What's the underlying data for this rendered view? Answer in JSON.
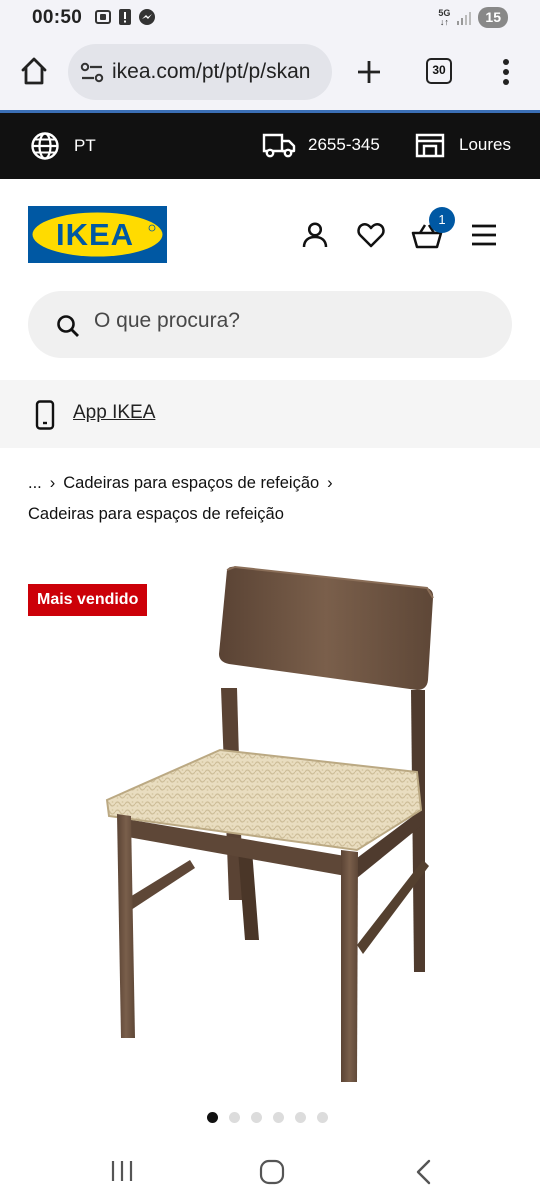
{
  "status_bar": {
    "time": "00:50",
    "network": "5G",
    "battery": "15"
  },
  "browser": {
    "url": "ikea.com/pt/pt/p/skan",
    "tab_count": "30"
  },
  "top_bar": {
    "language": "PT",
    "phone": "2655-345",
    "store": "Loures"
  },
  "header": {
    "logo_text": "IKEA",
    "cart_count": "1"
  },
  "search": {
    "placeholder": "O que procura?"
  },
  "app_banner": {
    "label": "App IKEA"
  },
  "breadcrumb": {
    "ellipsis": "...",
    "parent": "Cadeiras para espaços de refeição",
    "current": "Cadeiras para espaços de refeição"
  },
  "product": {
    "tag": "Mais vendido",
    "image_count": 6,
    "active_image": 1
  },
  "colors": {
    "ikea_blue": "#0058a3",
    "ikea_yellow": "#ffdb00",
    "tag_red": "#cc0008",
    "wood": "#6b5240",
    "seat": "#e8dcc0"
  }
}
